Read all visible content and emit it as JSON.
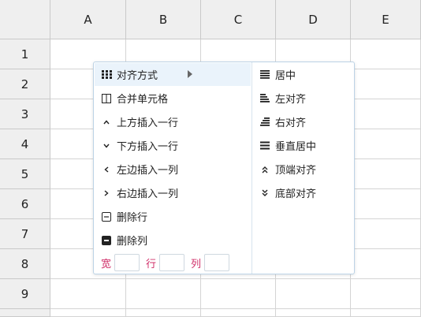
{
  "columns": [
    "A",
    "B",
    "C",
    "D",
    "E"
  ],
  "rows": [
    "1",
    "2",
    "3",
    "4",
    "5",
    "6",
    "7",
    "8",
    "9"
  ],
  "context_menu": {
    "items": [
      {
        "label": "对齐方式",
        "icon": "grid-icon",
        "has_submenu": true,
        "active": true
      },
      {
        "label": "合并单元格",
        "icon": "merge-cells-icon"
      },
      {
        "label": "上方插入一行",
        "icon": "chevron-up-icon"
      },
      {
        "label": "下方插入一行",
        "icon": "chevron-down-icon"
      },
      {
        "label": "左边插入一列",
        "icon": "chevron-left-icon"
      },
      {
        "label": "右边插入一列",
        "icon": "chevron-right-icon"
      },
      {
        "label": "删除行",
        "icon": "delete-row-icon"
      },
      {
        "label": "删除列",
        "icon": "delete-column-icon"
      }
    ],
    "size": {
      "width_label": "宽",
      "width_value": "",
      "row_label": "行",
      "row_value": "",
      "col_label": "列",
      "col_value": ""
    }
  },
  "align_submenu": {
    "items": [
      {
        "label": "居中",
        "icon": "align-center-icon"
      },
      {
        "label": "左对齐",
        "icon": "align-left-icon"
      },
      {
        "label": "右对齐",
        "icon": "align-right-icon"
      },
      {
        "label": "垂直居中",
        "icon": "align-middle-icon"
      },
      {
        "label": "顶端对齐",
        "icon": "align-top-icon"
      },
      {
        "label": "底部对齐",
        "icon": "align-bottom-icon"
      }
    ]
  },
  "colors": {
    "accent": "#d0306a",
    "menu_border": "#bcd3e6",
    "active_bg": "#eaf3fb",
    "header_bg": "#efefef"
  }
}
